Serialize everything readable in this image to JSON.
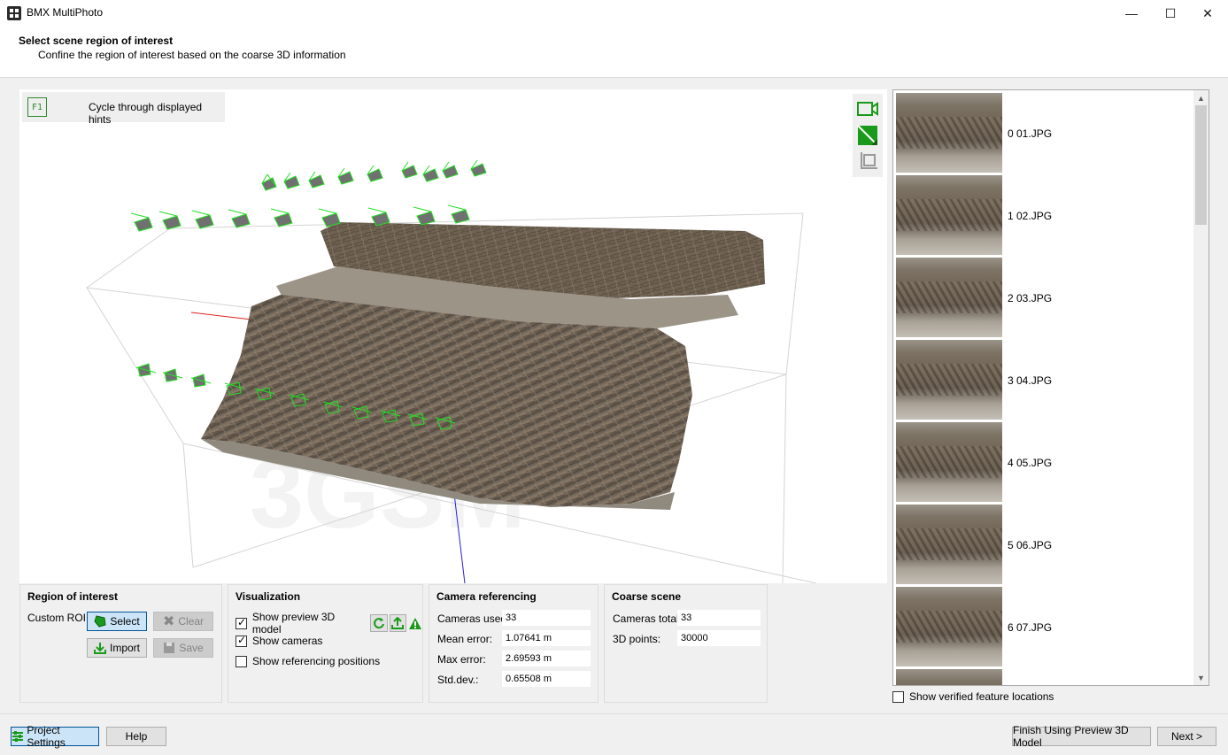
{
  "window": {
    "title": "BMX MultiPhoto",
    "minimize": "—",
    "maximize": "☐",
    "close": "✕"
  },
  "header": {
    "title": "Select scene region of interest",
    "subtitle": "Confine the region of interest based on the coarse 3D information"
  },
  "viewport": {
    "hint_key": "F1",
    "hint_text": "Cycle through displayed hints",
    "watermark": "3GSM"
  },
  "thumbnails": [
    {
      "label": "0 01.JPG"
    },
    {
      "label": "1 02.JPG"
    },
    {
      "label": "2 03.JPG"
    },
    {
      "label": "3 04.JPG"
    },
    {
      "label": "4 05.JPG"
    },
    {
      "label": "5 06.JPG"
    },
    {
      "label": "6 07.JPG"
    }
  ],
  "show_verified": {
    "label": "Show verified feature locations",
    "checked": false
  },
  "roi": {
    "title": "Region of interest",
    "custom_label": "Custom ROI:",
    "select": "Select",
    "clear": "Clear",
    "import": "Import",
    "save": "Save"
  },
  "visualization": {
    "title": "Visualization",
    "show_preview": "Show preview 3D model",
    "show_cameras": "Show cameras",
    "show_ref_positions": "Show referencing positions"
  },
  "camera_ref": {
    "title": "Camera referencing",
    "rows": [
      {
        "label": "Cameras used:",
        "value": "33"
      },
      {
        "label": "Mean error:",
        "value": "1.07641 m"
      },
      {
        "label": "Max error:",
        "value": "2.69593 m"
      },
      {
        "label": "Std.dev.:",
        "value": "0.65508 m"
      }
    ]
  },
  "coarse": {
    "title": "Coarse scene",
    "rows": [
      {
        "label": "Cameras total:",
        "value": "33"
      },
      {
        "label": "3D points:",
        "value": "30000"
      }
    ]
  },
  "bottom": {
    "project_settings": "Project Settings",
    "help": "Help",
    "finish": "Finish Using Preview 3D Model",
    "next": "Next >"
  },
  "colors": {
    "accent_green": "#1a9a1a",
    "camera_green": "#22dd22",
    "select_blue": "#cce4f7"
  }
}
